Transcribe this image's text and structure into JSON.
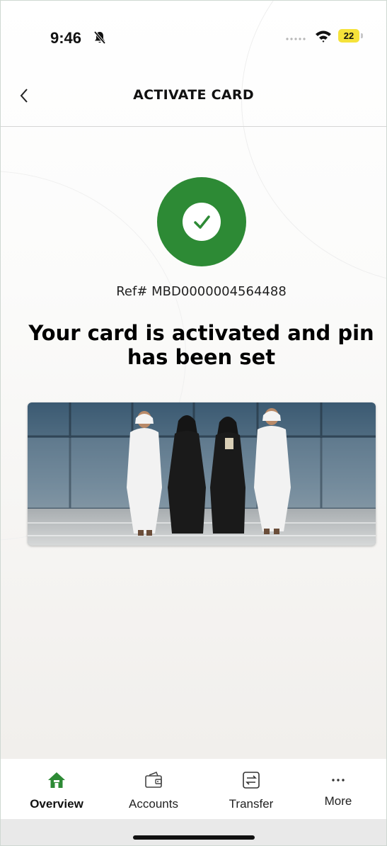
{
  "status_bar": {
    "time": "9:46",
    "battery": "22"
  },
  "header": {
    "title": "ACTIVATE CARD"
  },
  "result": {
    "reference": "Ref# MBD0000004564488",
    "message": "Your card is activated and pin has been set"
  },
  "bottom_nav": {
    "items": [
      {
        "label": "Overview",
        "icon": "home-icon",
        "active": true
      },
      {
        "label": "Accounts",
        "icon": "wallet-icon",
        "active": false
      },
      {
        "label": "Transfer",
        "icon": "transfer-icon",
        "active": false
      },
      {
        "label": "More",
        "icon": "more-icon",
        "active": false
      }
    ]
  },
  "colors": {
    "brand_green": "#2d8a35",
    "battery_yellow": "#f5e23a"
  }
}
